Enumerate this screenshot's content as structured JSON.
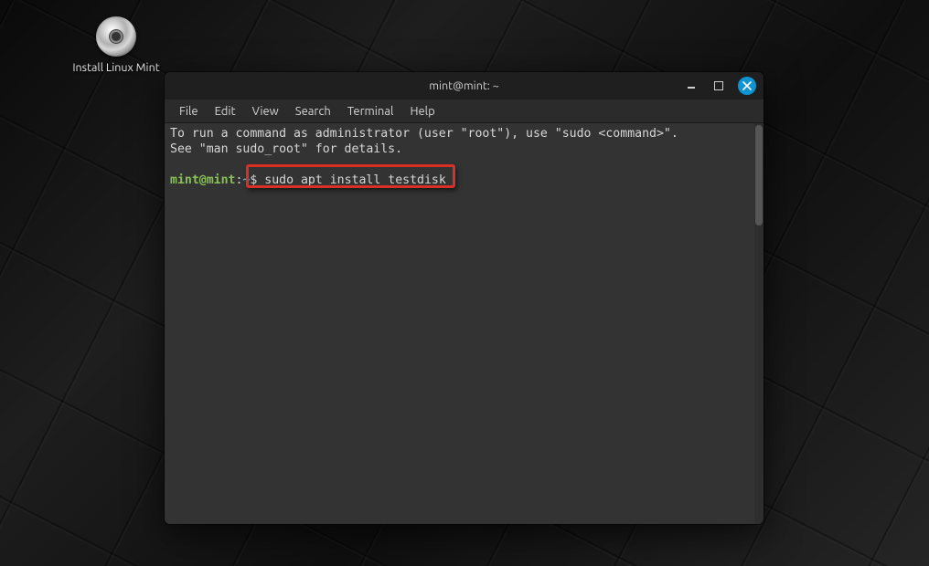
{
  "desktop": {
    "install_label": "Install Linux Mint"
  },
  "window": {
    "title": "mint@mint: ~",
    "menu": {
      "file": "File",
      "edit": "Edit",
      "view": "View",
      "search": "Search",
      "terminal": "Terminal",
      "help": "Help"
    }
  },
  "terminal": {
    "line1": "To run a command as administrator (user \"root\"), use \"sudo <command>\".",
    "line2": "See \"man sudo_root\" for details.",
    "prompt": {
      "user": "mint",
      "at": "@",
      "host": "mint",
      "colon": ":",
      "path": "~",
      "symbol": "$ "
    },
    "command": "sudo apt install testdisk"
  }
}
